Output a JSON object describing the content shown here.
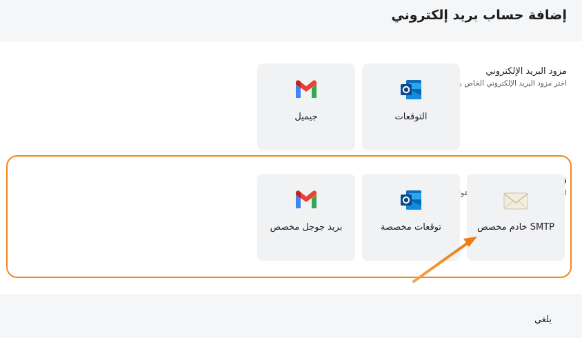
{
  "dialog": {
    "title": "إضافة حساب بريد إلكتروني"
  },
  "provider_section": {
    "title": "مزود البريد الإلكتروني",
    "description": "اختر مزود البريد الإلكتروني الخاص بك."
  },
  "template_section": {
    "title": "قالب الاتصال",
    "description": "اختر قالب اتصال للحصول على حقول محددة مسبقًا لتسهيل الإعداد."
  },
  "provider_cards": [
    {
      "label": "التوقعات",
      "icon": "outlook-icon"
    },
    {
      "label": "جيميل",
      "icon": "gmail-icon"
    }
  ],
  "template_cards": [
    {
      "label": "SMTP خادم مخصص",
      "icon": "envelope-icon"
    },
    {
      "label": "توقعات مخصصة",
      "icon": "outlook-icon"
    },
    {
      "label": "بريد جوجل مخصص",
      "icon": "gmail-icon"
    }
  ],
  "footer": {
    "cancel_label": "يلغي"
  },
  "colors": {
    "highlight": "#f0861f",
    "card_bg": "#f1f2f4",
    "outlook_blue": "#0f6cbd"
  }
}
